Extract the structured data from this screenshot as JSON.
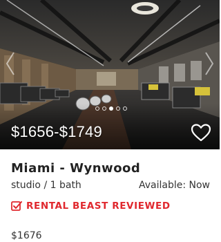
{
  "listing": {
    "price_range": "$1656-$1749",
    "title": "Miami - Wynwood",
    "unit_type": "studio / 1 bath",
    "availability": "Available: Now",
    "badge_label": "RENTAL BEAST REVIEWED",
    "rent": "$1676"
  },
  "gallery": {
    "dot_count": 5,
    "active_dot": 2,
    "icons": [
      "chevron-left-icon",
      "chevron-right-icon",
      "heart-icon",
      "checkbox-check-icon"
    ]
  },
  "colors": {
    "accent_red": "#e0282e",
    "text_dark": "#222222",
    "overlay_text": "#ffffff"
  }
}
